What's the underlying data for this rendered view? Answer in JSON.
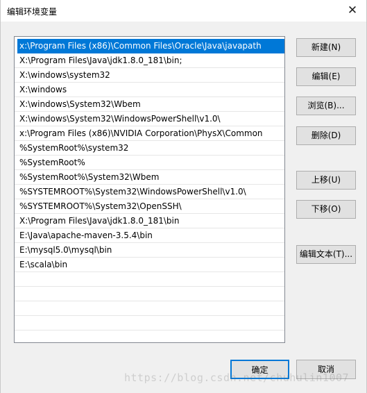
{
  "window": {
    "title": "编辑环境变量",
    "close_glyph": "✕"
  },
  "paths": [
    "x:\\Program Files (x86)\\Common Files\\Oracle\\Java\\javapath",
    "X:\\Program Files\\Java\\jdk1.8.0_181\\bin;",
    "X:\\windows\\system32",
    "X:\\windows",
    "X:\\windows\\System32\\Wbem",
    "X:\\windows\\System32\\WindowsPowerShell\\v1.0\\",
    "x:\\Program Files (x86)\\NVIDIA Corporation\\PhysX\\Common",
    "%SystemRoot%\\system32",
    "%SystemRoot%",
    "%SystemRoot%\\System32\\Wbem",
    "%SYSTEMROOT%\\System32\\WindowsPowerShell\\v1.0\\",
    "%SYSTEMROOT%\\System32\\OpenSSH\\",
    "X:\\Program Files\\Java\\jdk1.8.0_181\\bin",
    "E:\\Java\\apache-maven-3.5.4\\bin",
    "E:\\mysql5.0\\mysql\\bin",
    "E:\\scala\\bin",
    "",
    "",
    "",
    "",
    ""
  ],
  "selected_index": 0,
  "buttons": {
    "new": "新建(N)",
    "edit": "编辑(E)",
    "browse": "浏览(B)...",
    "delete": "删除(D)",
    "move_up": "上移(U)",
    "move_down": "下移(O)",
    "edit_text": "编辑文本(T)...",
    "ok": "确定",
    "cancel": "取消"
  },
  "watermark": "https://blog.csdn.net/chuhulin1007"
}
